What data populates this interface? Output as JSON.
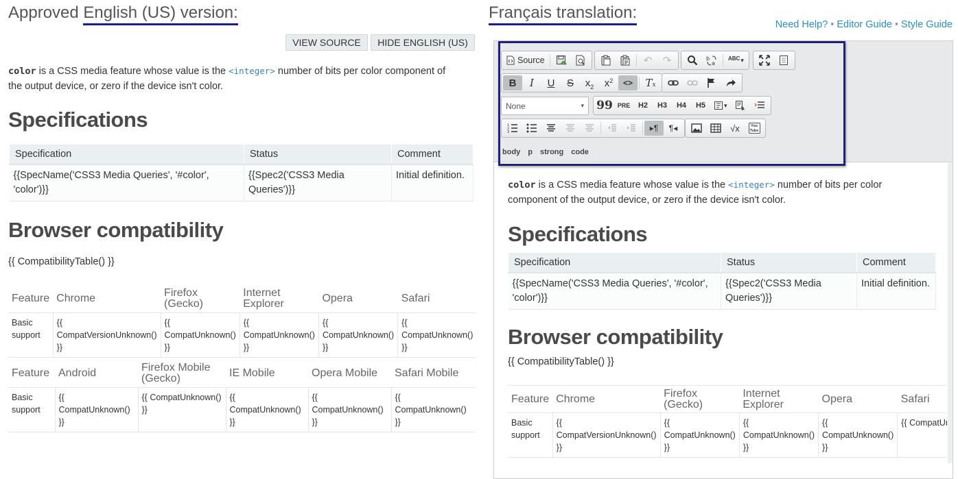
{
  "left": {
    "title_prefix": "Approved ",
    "title_underlined": "English (US) version:",
    "buttons": {
      "view_source": "VIEW SOURCE",
      "hide_english": "HIDE ENGLISH (US)"
    },
    "intro": {
      "code_term": "color",
      "text_before_link": " is a CSS media feature whose value is the ",
      "link": "<integer>",
      "text_line1_end": " number of bits per color component of",
      "text_line2": "the output device, or zero if the device isn't color."
    },
    "spec_heading": "Specifications",
    "spec_table": {
      "headers": [
        "Specification",
        "Status",
        "Comment"
      ],
      "row": [
        "{{SpecName('CSS3 Media Queries', '#color', 'color')}}",
        "{{Spec2('CSS3 Media Queries')}}",
        "Initial definition."
      ]
    },
    "compat_heading": "Browser compatibility",
    "compat_macro": "{{ CompatibilityTable() }}",
    "desktop_table": {
      "headers": [
        "Feature",
        "Chrome",
        "Firefox (Gecko)",
        "Internet Explorer",
        "Opera",
        "Safari"
      ],
      "row": [
        "Basic support",
        "{{ CompatVersionUnknown() }}",
        "{{ CompatUnknown() }}",
        "{{ CompatUnknown() }}",
        "{{ CompatUnknown() }}",
        "{{ CompatUnknown() }}"
      ]
    },
    "mobile_table": {
      "headers": [
        "Feature",
        "Android",
        "Firefox Mobile (Gecko)",
        "IE Mobile",
        "Opera Mobile",
        "Safari Mobile"
      ],
      "row": [
        "Basic support",
        "{{ CompatUnknown() }}",
        "{{ CompatUnknown() }}",
        "{{ CompatUnknown() }}",
        "{{ CompatUnknown() }}",
        "{{ CompatUnknown() }}"
      ]
    }
  },
  "right": {
    "title": "Français translation:",
    "help_links": [
      "Need Help?",
      "Editor Guide",
      "Style Guide"
    ],
    "help_separator": "•",
    "toolbar": {
      "source_label": "Source",
      "format_select_value": "None",
      "quote_label": "99",
      "pre_label": "PRE",
      "h2": "H2",
      "h3": "H3",
      "h4": "H4",
      "h5": "H5",
      "abc_label": "ABC",
      "math_label": "√x",
      "youtube_label": "You Tube"
    },
    "breadcrumbs": [
      "body",
      "p",
      "strong",
      "code"
    ],
    "content": {
      "code_term": "color",
      "text_before_link": " is a CSS media feature whose value is the ",
      "link": "<integer>",
      "text_line1_end": " number of bits per color",
      "text_line2": "component of the output device, or zero if the device isn't color.",
      "spec_heading": "Specifications",
      "spec_table": {
        "headers": [
          "Specification",
          "Status",
          "Comment"
        ],
        "row": [
          "{{SpecName('CSS3 Media Queries', '#color', 'color')}}",
          "{{Spec2('CSS3 Media Queries')}}",
          "Initial definition."
        ]
      },
      "compat_heading": "Browser compatibility",
      "compat_macro": "{{ CompatibilityTable() }}",
      "desktop_table": {
        "headers": [
          "Feature",
          "Chrome",
          "Firefox (Gecko)",
          "Internet Explorer",
          "Opera",
          "Safari"
        ],
        "row": [
          "Basic support",
          "{{ CompatVersionUnknown() }}",
          "{{ CompatUnknown() }}",
          "{{ CompatUnknown() }}",
          "{{ CompatUnknown() }}",
          "{{ CompatUnkn"
        ]
      }
    }
  },
  "colors": {
    "link": "#2a8ec7",
    "heading_underline": "#1b1f8a",
    "toolbar_bg": "#e7e9ea"
  }
}
